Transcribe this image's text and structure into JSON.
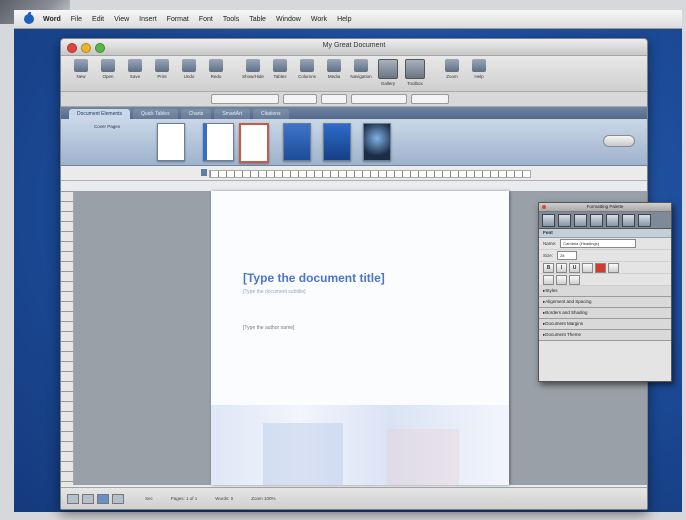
{
  "menubar": {
    "items": [
      "Word",
      "File",
      "Edit",
      "View",
      "Insert",
      "Format",
      "Font",
      "Tools",
      "Table",
      "Window",
      "Work",
      "Help"
    ]
  },
  "window": {
    "title": "My Great Document"
  },
  "toolbar": {
    "buttons": [
      "New",
      "Open",
      "Save",
      "Print",
      "Undo",
      "Redo",
      "Show/Hide",
      "Tables",
      "Columns",
      "Media",
      "Navigation",
      "Gallery",
      "Toolbox",
      "Zoom",
      "Help"
    ]
  },
  "ribbon": {
    "tabs": [
      "Document Elements",
      "Quick Tables",
      "Charts",
      "SmartArt",
      "Citations"
    ],
    "active_tab": "Document Elements",
    "gallery_label": "Cover Pages"
  },
  "document": {
    "title": "[Type the document title]",
    "subtitle": "[Type the document subtitle]",
    "body": "[Type the author name]"
  },
  "status": {
    "fields": [
      "Sec",
      "Pages: 1 of 1",
      "Words: 0",
      "Zoom 100%"
    ]
  },
  "palette": {
    "title": "Formatting Palette",
    "section": "Font",
    "name_label": "Name:",
    "name_value": "Cambria (Headings)",
    "size_label": "Size:",
    "size_value": "28",
    "collapsed": [
      "Styles",
      "Alignment and Spacing",
      "Borders and Shading",
      "Document Margins",
      "Document Theme"
    ]
  },
  "colors": {
    "accent": "#4b74cc",
    "desktop": "#1e4f9e",
    "ribbon": "#52698a"
  }
}
